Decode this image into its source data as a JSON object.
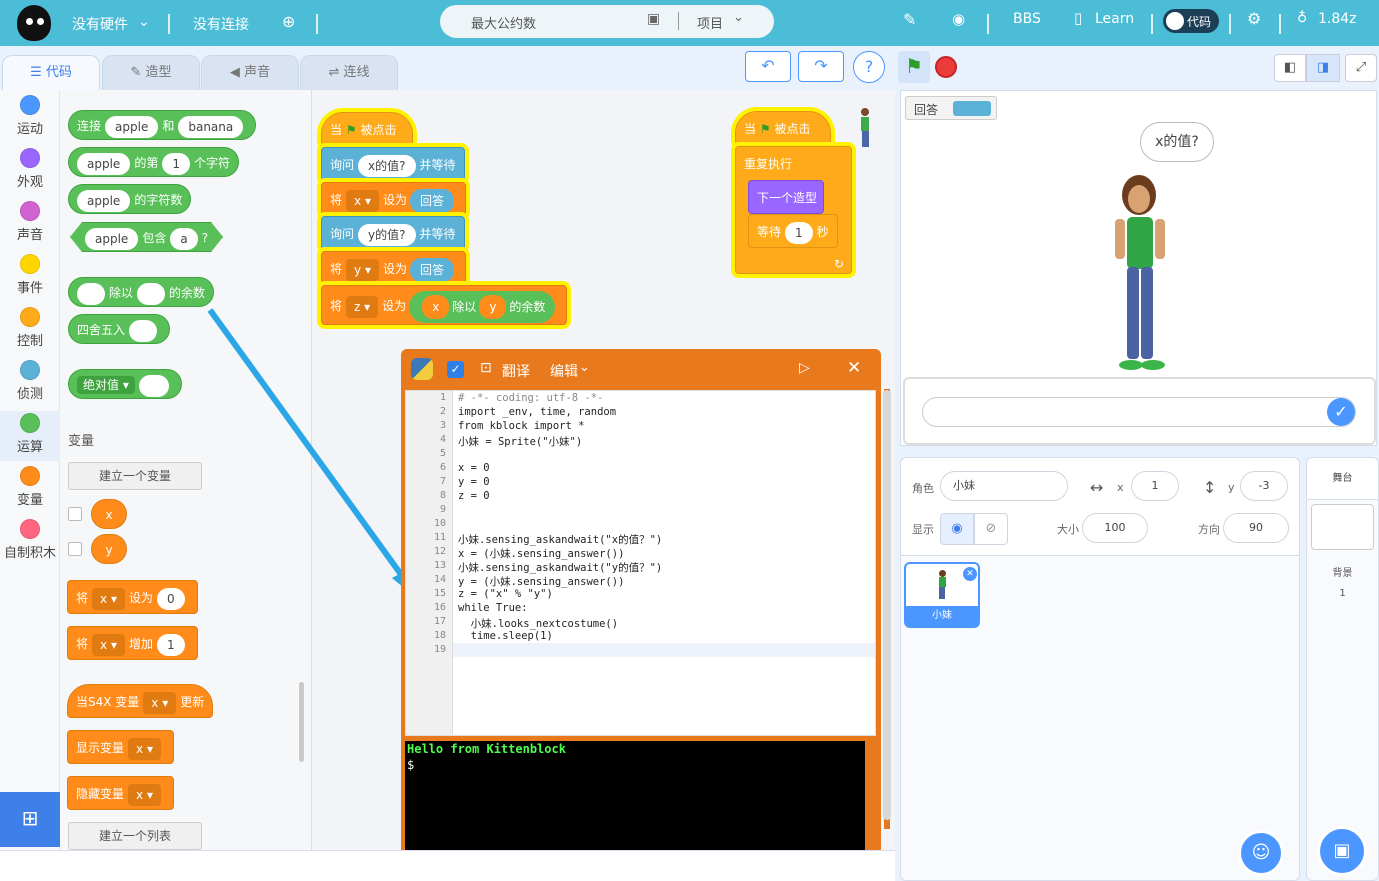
{
  "topbar": {
    "no_hardware": "没有硬件",
    "no_connection": "没有连接",
    "project_name": "最大公约数",
    "project_menu": "项目",
    "bbs": "BBS",
    "learn": "Learn",
    "code_toggle": "代码",
    "version": "1.84z"
  },
  "tabs": [
    {
      "label": "代码"
    },
    {
      "label": "造型"
    },
    {
      "label": "声音"
    },
    {
      "label": "连线"
    }
  ],
  "categories": [
    {
      "label": "运动",
      "color": "#4c97ff"
    },
    {
      "label": "外观",
      "color": "#9966ff"
    },
    {
      "label": "声音",
      "color": "#cf63cf"
    },
    {
      "label": "事件",
      "color": "#ffd500"
    },
    {
      "label": "控制",
      "color": "#ffab19"
    },
    {
      "label": "侦测",
      "color": "#5cb1d6"
    },
    {
      "label": "运算",
      "color": "#59c059"
    },
    {
      "label": "变量",
      "color": "#ff8c1a"
    },
    {
      "label": "自制积木",
      "color": "#ff6680"
    }
  ],
  "palette": {
    "join": {
      "a": "连接",
      "v1": "apple",
      "b": "和",
      "v2": "banana"
    },
    "letter": {
      "v1": "apple",
      "a": "的第",
      "n": "1",
      "b": "个字符"
    },
    "length": {
      "v1": "apple",
      "a": "的字符数"
    },
    "contains": {
      "v1": "apple",
      "a": "包含",
      "v2": "a",
      "q": "?"
    },
    "mod": {
      "a": "除以",
      "b": "的余数"
    },
    "round": {
      "a": "四舍五入"
    },
    "abs": {
      "a": "绝对值"
    },
    "variables_title": "变量",
    "make_var": "建立一个变量",
    "vars": [
      "x",
      "y"
    ],
    "set": {
      "a": "将",
      "var": "x",
      "b": "设为",
      "v": "0"
    },
    "change": {
      "a": "将",
      "var": "x",
      "b": "增加",
      "v": "1"
    },
    "s4x": {
      "a": "当S4X 变量",
      "var": "x",
      "b": "更新"
    },
    "show": {
      "a": "显示变量",
      "var": "x"
    },
    "hide": {
      "a": "隐藏变量",
      "var": "x"
    },
    "make_list": "建立一个列表"
  },
  "script1": {
    "when": "当",
    "clicked": "被点击",
    "ask1": {
      "a": "询问",
      "q": "x的值?",
      "b": "并等待"
    },
    "set1": {
      "a": "将",
      "var": "x",
      "b": "设为",
      "v": "回答"
    },
    "ask2": {
      "a": "询问",
      "q": "y的值?",
      "b": "并等待"
    },
    "set2": {
      "a": "将",
      "var": "y",
      "b": "设为",
      "v": "回答"
    },
    "set3": {
      "a": "将",
      "var": "z",
      "b": "设为",
      "x": "x",
      "mod": "除以",
      "y": "y",
      "rem": "的余数"
    }
  },
  "script2": {
    "when": "当",
    "clicked": "被点击",
    "forever": "重复执行",
    "next_costume": "下一个造型",
    "wait": {
      "a": "等待",
      "v": "1",
      "b": "秒"
    }
  },
  "pywindow": {
    "translate": "翻译",
    "edit": "编辑"
  },
  "code_lines": [
    {
      "n": "1",
      "t": "# -*- coding: utf-8 -*-",
      "c": "cm"
    },
    {
      "n": "2",
      "t": "import _env, time, random",
      "c": ""
    },
    {
      "n": "3",
      "t": "from kblock import *",
      "c": ""
    },
    {
      "n": "4",
      "t": "小妹 = Sprite(\"小妹\")",
      "c": ""
    },
    {
      "n": "5",
      "t": "",
      "c": ""
    },
    {
      "n": "6",
      "t": "x = 0",
      "c": ""
    },
    {
      "n": "7",
      "t": "y = 0",
      "c": ""
    },
    {
      "n": "8",
      "t": "z = 0",
      "c": ""
    },
    {
      "n": "9",
      "t": "",
      "c": ""
    },
    {
      "n": "10",
      "t": "",
      "c": ""
    },
    {
      "n": "11",
      "t": "小妹.sensing_askandwait(\"x的值？\")",
      "c": ""
    },
    {
      "n": "12",
      "t": "x = (小妹.sensing_answer())",
      "c": ""
    },
    {
      "n": "13",
      "t": "小妹.sensing_askandwait(\"y的值？\")",
      "c": ""
    },
    {
      "n": "14",
      "t": "y = (小妹.sensing_answer())",
      "c": ""
    },
    {
      "n": "15",
      "t": "z = (\"x\" % \"y\")",
      "c": ""
    },
    {
      "n": "16",
      "t": "while True:",
      "c": ""
    },
    {
      "n": "17",
      "t": "  小妹.looks_nextcostume()",
      "c": ""
    },
    {
      "n": "18",
      "t": "  time.sleep(1)",
      "c": ""
    },
    {
      "n": "19",
      "t": "",
      "c": ""
    }
  ],
  "terminal": {
    "line1": "Hello from Kittenblock",
    "prompt": "$"
  },
  "stage": {
    "answer_label": "回答",
    "bubble": "x的值?"
  },
  "sprite_info": {
    "sprite_label": "角色",
    "sprite_name": "小妹",
    "x_label": "x",
    "x_value": "1",
    "y_label": "y",
    "y_value": "-3",
    "show_label": "显示",
    "size_label": "大小",
    "size_value": "100",
    "dir_label": "方向",
    "dir_value": "90",
    "thumb_name": "小妹"
  },
  "stage_panel": {
    "title": "舞台",
    "backdrop_label": "背景",
    "backdrop_count": "1"
  },
  "colors": {
    "topbar": "#4cbdd6",
    "operators": "#59c059",
    "variables": "#ff8c1a",
    "sensing": "#5cb1d6",
    "control": "#ffab19",
    "looks": "#9966ff"
  }
}
